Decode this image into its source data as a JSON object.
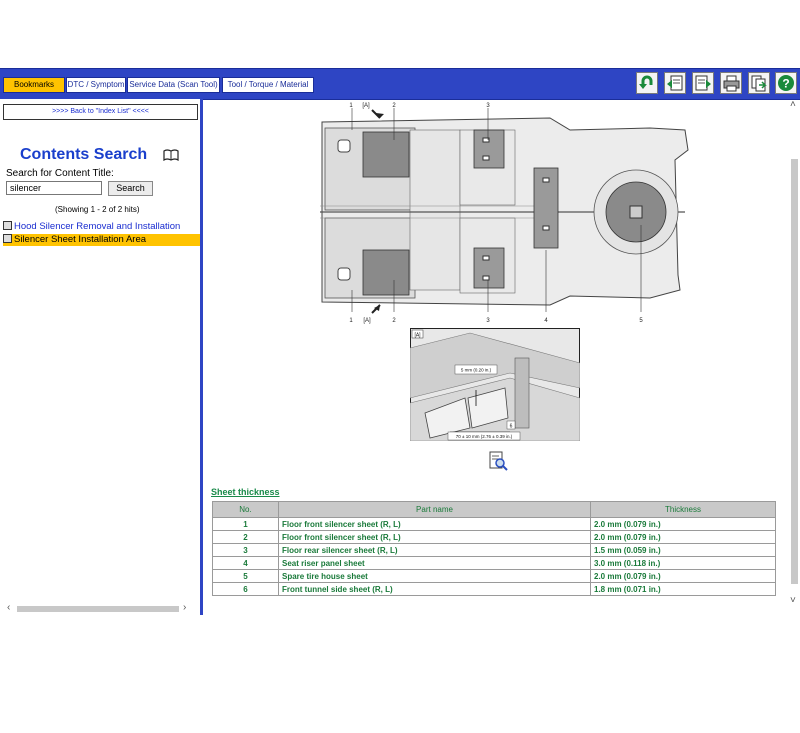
{
  "toolbar": {
    "tabs": [
      {
        "label": "Bookmarks",
        "active": true
      },
      {
        "label": "DTC / Symptom",
        "active": false
      },
      {
        "label": "Service Data (Scan Tool)",
        "active": false
      },
      {
        "label": "Tool / Torque / Material",
        "active": false
      }
    ],
    "icons": [
      "back-arrow-icon",
      "previous-page-icon",
      "next-page-icon",
      "print-icon",
      "export-icon",
      "help-icon"
    ],
    "colors": {
      "bar": "#2e45c4",
      "active_tab": "#ffc300"
    }
  },
  "sidebar": {
    "back_link": ">>>> Back to \"Index List\" <<<<",
    "title": "Contents Search",
    "search_label": "Search for Content Title:",
    "search_value": "silencer",
    "search_button": "Search",
    "hits_text": "(Showing 1 - 2 of 2 hits)",
    "results": [
      {
        "label": "Hood Silencer Removal and Installation",
        "selected": false
      },
      {
        "label": "Silencer Sheet Installation Area",
        "selected": true
      }
    ]
  },
  "diagram": {
    "top_callouts": [
      "1",
      "[A]",
      "2",
      "3"
    ],
    "bottom_callouts": [
      "1",
      "[A]",
      "2",
      "3",
      "4",
      "5"
    ],
    "detail_label": "[A]",
    "detail_dim_1": "5 mm (0.20 in.)",
    "detail_dim_2": "70 ± 10 mm (2.76 ± 0.39 in.)",
    "detail_callout": "6"
  },
  "sheet": {
    "title": "Sheet thickness",
    "columns": [
      "No.",
      "Part name",
      "Thickness"
    ],
    "rows": [
      [
        "1",
        "Floor front silencer sheet (R, L)",
        "2.0 mm (0.079 in.)"
      ],
      [
        "2",
        "Floor front silencer sheet (R, L)",
        "2.0 mm (0.079 in.)"
      ],
      [
        "3",
        "Floor rear silencer sheet (R, L)",
        "1.5 mm (0.059 in.)"
      ],
      [
        "4",
        "Seat riser panel sheet",
        "3.0 mm (0.118 in.)"
      ],
      [
        "5",
        "Spare tire house sheet",
        "2.0 mm (0.079 in.)"
      ],
      [
        "6",
        "Front tunnel side sheet (R, L)",
        "1.8 mm (0.071 in.)"
      ]
    ]
  }
}
